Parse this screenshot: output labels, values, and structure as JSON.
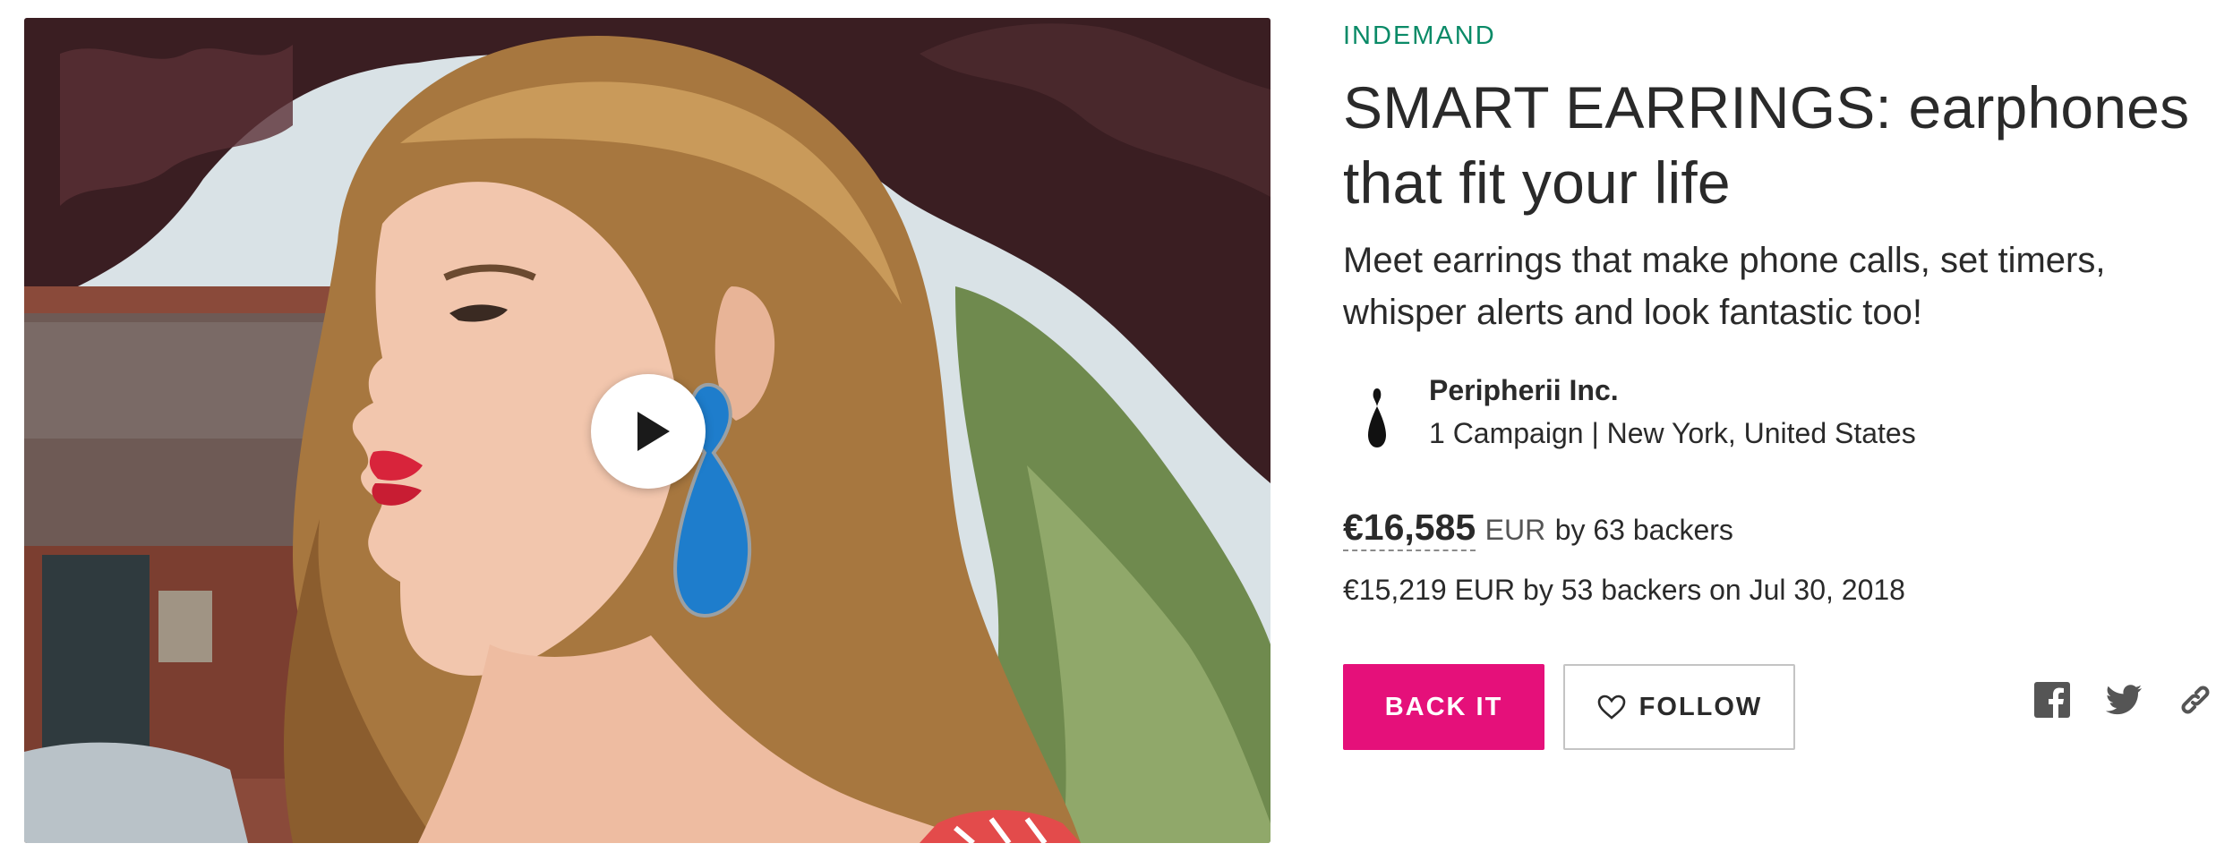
{
  "media": {
    "play_icon": "play-icon"
  },
  "campaign": {
    "platform_label": "INDEMAND",
    "title": "SMART EARRINGS: earphones that fit your life",
    "tagline": "Meet earrings that make phone calls, set timers, whisper alerts and look fantastic too!"
  },
  "owner": {
    "logo_icon": "earring-drop-icon",
    "name": "Peripherii Inc.",
    "meta": "1 Campaign | New York, United States"
  },
  "funding": {
    "raised_amount": "€16,585",
    "raised_currency": "EUR",
    "raised_backers": "by 63 backers",
    "history": "€15,219 EUR by 53 backers on Jul 30, 2018"
  },
  "actions": {
    "back_label": "BACK IT",
    "follow_label": "FOLLOW",
    "follow_icon": "heart-outline-icon"
  },
  "share": {
    "icons": [
      "facebook-icon",
      "twitter-icon",
      "link-icon"
    ]
  },
  "colors": {
    "accent": "#e5107a",
    "platform_label": "#0a8a67",
    "text": "#2a2a2a",
    "share_icons": "#555555"
  }
}
